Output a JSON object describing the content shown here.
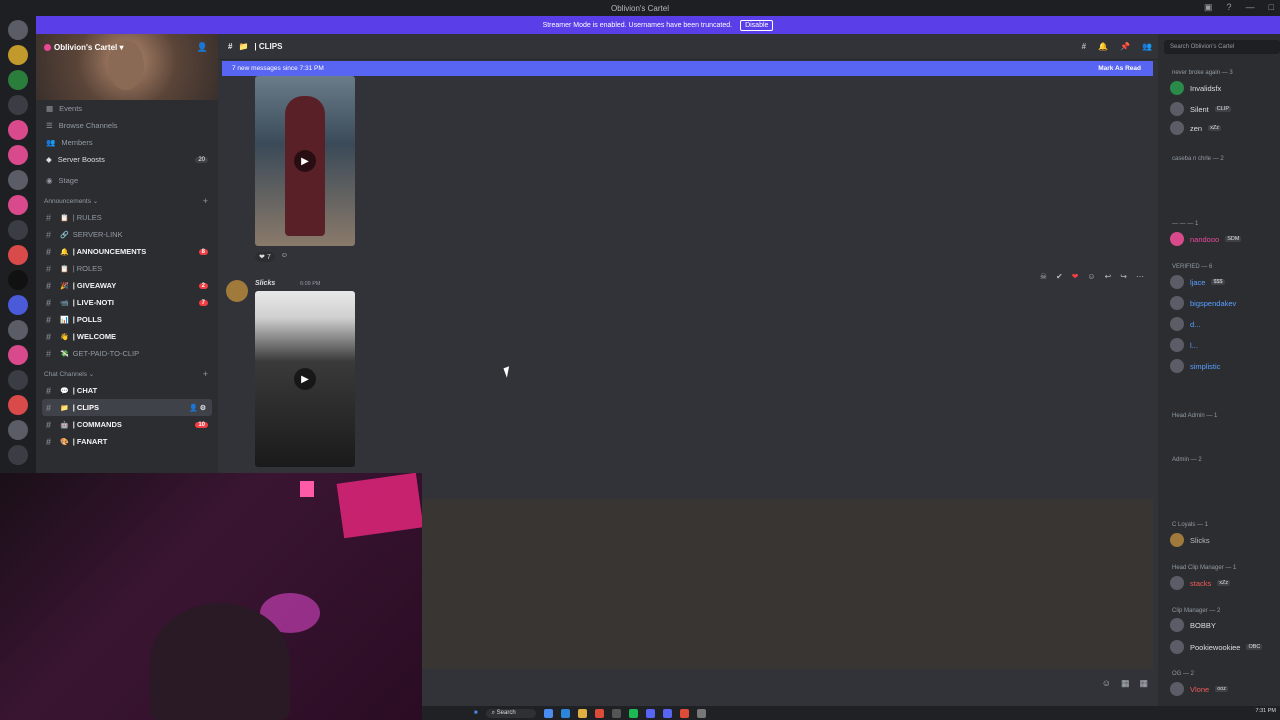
{
  "window": {
    "title": "Oblivion's Cartel"
  },
  "banner": {
    "text": "Streamer Mode is enabled. Usernames have been truncated.",
    "button": "Disable"
  },
  "server": {
    "name": "Oblivion's Cartel"
  },
  "sidebar": {
    "menu": [
      {
        "label": "Events"
      },
      {
        "label": "Browse Channels"
      },
      {
        "label": "Members"
      },
      {
        "label": "Server Boosts",
        "badge": "20"
      }
    ],
    "stage": "Stage",
    "categories": {
      "announcements": "Announcements",
      "chat": "Chat Channels"
    },
    "announcement_channels": [
      {
        "emoji": "📋",
        "label": "| RULES",
        "bold": false
      },
      {
        "emoji": "🔗",
        "label": "SERVER-LINK",
        "bold": false
      },
      {
        "emoji": "🔔",
        "label": "| ANNOUNCEMENTS",
        "bold": true,
        "pill": "8"
      },
      {
        "emoji": "📋",
        "label": "| ROLES",
        "bold": false
      },
      {
        "emoji": "🎉",
        "label": "| GIVEAWAY",
        "bold": true,
        "pill": "2"
      },
      {
        "emoji": "📹",
        "label": "| LIVE-NOTI",
        "bold": true,
        "pill": "7"
      },
      {
        "emoji": "📊",
        "label": "| POLLS",
        "bold": true
      },
      {
        "emoji": "👋",
        "label": "| WELCOME",
        "bold": true
      },
      {
        "emoji": "💸",
        "label": "GET-PAID-TO-CLIP",
        "bold": false
      }
    ],
    "chat_channels": [
      {
        "emoji": "💬",
        "label": "| CHAT",
        "bold": true
      },
      {
        "emoji": "📁",
        "label": "| CLIPS",
        "bold": true,
        "active": true
      },
      {
        "emoji": "🤖",
        "label": "| COMMANDS",
        "bold": true,
        "pill": "10"
      },
      {
        "emoji": "🎨",
        "label": "| FANART",
        "bold": true
      }
    ]
  },
  "channel": {
    "name": "| CLIPS",
    "new_messages": "7 new messages since 7:31 PM",
    "mark_read": "Mark As Read",
    "reaction_count": "7",
    "author": "Slicks",
    "time": "6:09 PM"
  },
  "members": {
    "search_placeholder": "Search Oblivion's Cartel",
    "groups": [
      {
        "label": "never broke again — 3"
      },
      {
        "label": "caseba n chrle — 2"
      },
      {
        "label": "— — — 1"
      },
      {
        "label": "VERIFIED — 6"
      },
      {
        "label": "Head Admin — 1"
      },
      {
        "label": "Admin — 2"
      },
      {
        "label": "C Loyals — 1"
      },
      {
        "label": "Head Clip Manager — 1"
      },
      {
        "label": "Clip Manager — 2"
      },
      {
        "label": "OG — 2"
      }
    ],
    "people": [
      {
        "name": "Invalidsfx"
      },
      {
        "name": "Silent",
        "tag": "CLIP"
      },
      {
        "name": "zen",
        "tag": "xZz"
      },
      {
        "name": "nandooo",
        "tag": "SDM"
      },
      {
        "name": "ljace",
        "tag": "$$$"
      },
      {
        "name": "bigspendakev"
      },
      {
        "name": "d..."
      },
      {
        "name": "l..."
      },
      {
        "name": "simplistic"
      },
      {
        "name": "Slicks"
      },
      {
        "name": "stacks",
        "tag": "xZz"
      },
      {
        "name": "BOBBY"
      },
      {
        "name": "Pookiewookiee",
        "tag": "OBC"
      },
      {
        "name": "Vlone",
        "tag": "ooz"
      }
    ]
  },
  "taskbar": {
    "search": "Search",
    "time": "7:31 PM"
  },
  "colors": {
    "accent": "#5865f2",
    "banner": "#5a3ee8",
    "unread": "#f23f43"
  }
}
